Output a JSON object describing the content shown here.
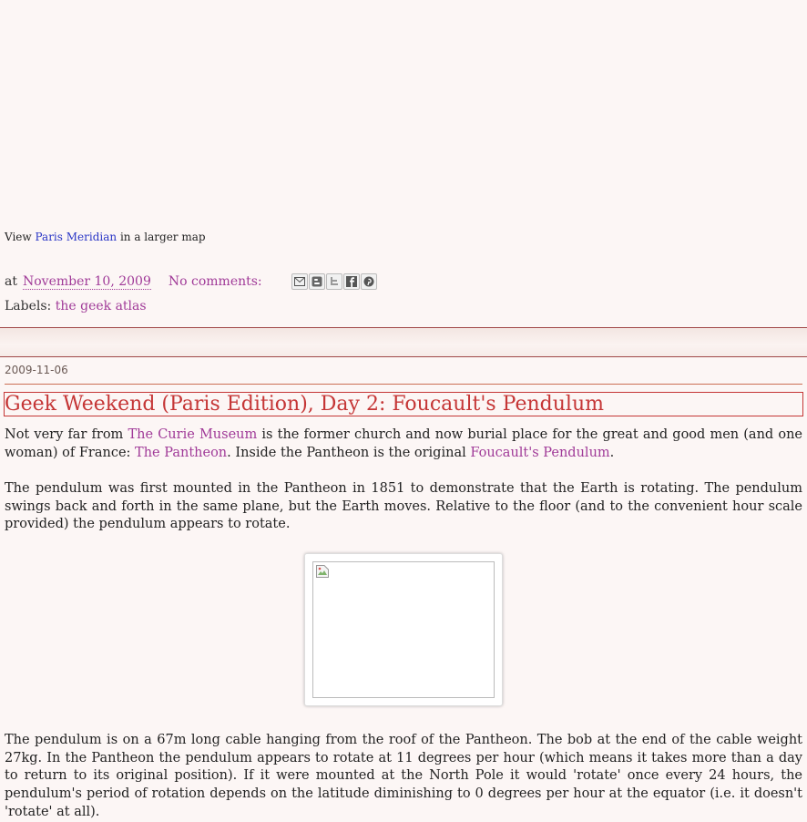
{
  "map_caption": {
    "prefix": "View",
    "link": "Paris Meridian",
    "suffix": "in a larger map"
  },
  "post_footer": {
    "at": "at",
    "timestamp": "November 10, 2009",
    "comments": "No comments:",
    "share_icons": [
      "email-icon",
      "blogger-icon",
      "twitter-icon",
      "facebook-icon",
      "pinterest-icon"
    ]
  },
  "labels": {
    "prefix": "Labels:",
    "label": "the geek atlas"
  },
  "date_header": "2009-11-06",
  "post_title": "Geek Weekend (Paris Edition), Day 2: Foucault's Pendulum",
  "paragraph1": {
    "t1": "Not very far from ",
    "link1": "The Curie Museum",
    "t2": " is the former church and now burial place for the great and good men (and one woman) of France: ",
    "link2": "The Pantheon",
    "t3": ". Inside the Pantheon is the original ",
    "link3": "Foucault's Pendulum",
    "t4": "."
  },
  "paragraph2": "The pendulum was first mounted in the Pantheon in 1851 to demonstrate that the Earth is rotating. The pendulum swings back and forth in the same plane, but the Earth moves. Relative to the floor (and to the convenient hour scale provided) the pendulum appears to rotate.",
  "paragraph3": "The pendulum is on a 67m long cable hanging from the roof of the Pantheon. The bob at the end of the cable weight 27kg. In the Pantheon the pendulum appears to rotate at 11 degrees per hour (which means it takes more than a day to return to its original position). If it were mounted at the North Pole it would 'rotate' once every 24 hours, the pendulum's period of rotation depends on the latitude diminishing to 0 degrees per hour at the equator (i.e. it doesn't 'rotate' at all).",
  "colors": {
    "background": "#fcf6f5",
    "link": "#a03a98",
    "map_link": "#2a36c6",
    "title": "#c53636",
    "rule": "#cc6f55"
  }
}
